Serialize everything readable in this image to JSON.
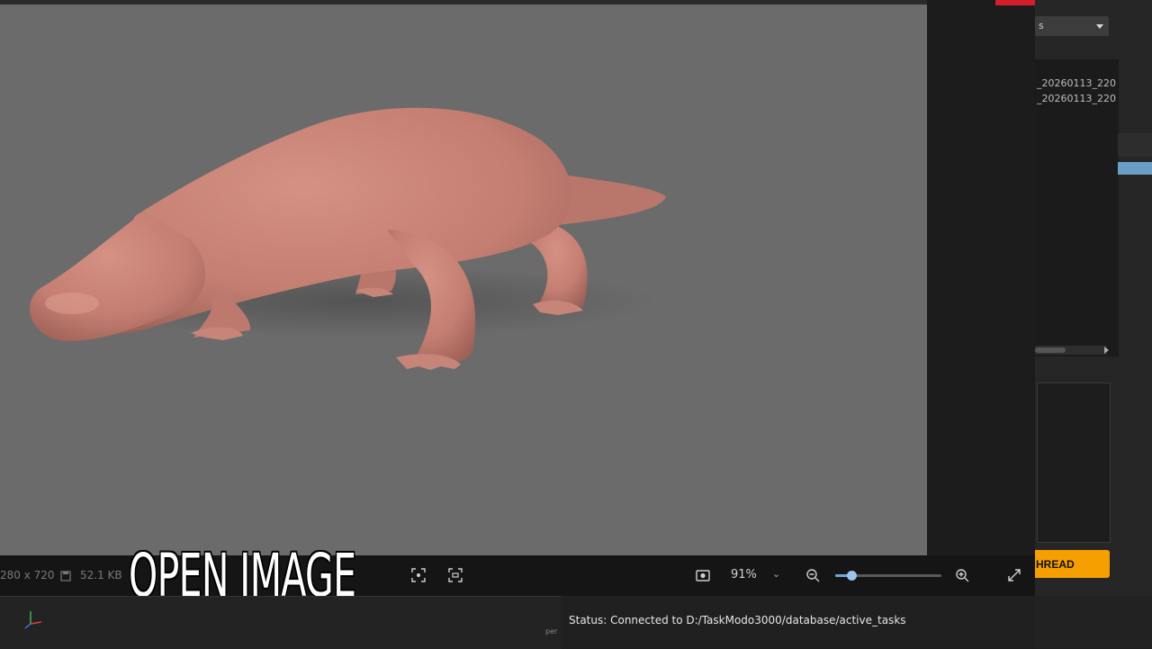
{
  "viewport": {
    "model_name": "platypus-sculpt",
    "model_color": "#c47e72",
    "background_color": "#6b6b6b"
  },
  "toolbar": {
    "image_size": "280 x 720",
    "file_size": "52.1 KB",
    "zoom_level": "91%",
    "zoom_fraction": 0.15
  },
  "overlay": {
    "caption": "OPEN IMAGE"
  },
  "side_panel": {
    "dropdown_value": "s",
    "files": [
      "_20260113_220",
      "_20260113_220"
    ],
    "thread_button_label": "HREAD"
  },
  "viewport_corner": {
    "camera_label": "per"
  },
  "status": {
    "text": "Status: Connected to D:/TaskModo3000/database/active_tasks"
  },
  "icons": [
    "image-info-icon",
    "disk-icon",
    "fit-screen-icon",
    "crop-icon",
    "screenshot-icon",
    "zoom-out-icon",
    "zoom-in-icon",
    "expand-icon",
    "axis-gizmo-icon",
    "dropdown-chevron-icon"
  ]
}
